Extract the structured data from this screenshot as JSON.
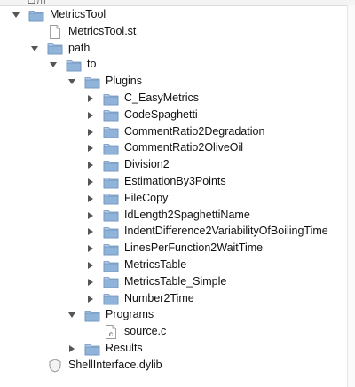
{
  "window": {
    "top_label": "ロ川"
  },
  "tree": [
    {
      "label": "MetricsTool",
      "icon": "folder-icon",
      "expanded": true
    },
    {
      "label": "MetricsTool.st",
      "icon": "file-icon"
    },
    {
      "label": "path",
      "icon": "folder-icon",
      "expanded": true
    },
    {
      "label": "to",
      "icon": "folder-icon",
      "expanded": true
    },
    {
      "label": "Plugins",
      "icon": "folder-icon",
      "expanded": true
    },
    {
      "label": "C_EasyMetrics",
      "icon": "folder-icon",
      "expanded": false
    },
    {
      "label": "CodeSpaghetti",
      "icon": "folder-icon",
      "expanded": false
    },
    {
      "label": "CommentRatio2Degradation",
      "icon": "folder-icon",
      "expanded": false
    },
    {
      "label": "CommentRatio2OliveOil",
      "icon": "folder-icon",
      "expanded": false
    },
    {
      "label": "Division2",
      "icon": "folder-icon",
      "expanded": false
    },
    {
      "label": "EstimationBy3Points",
      "icon": "folder-icon",
      "expanded": false
    },
    {
      "label": "FileCopy",
      "icon": "folder-icon",
      "expanded": false
    },
    {
      "label": "IdLength2SpaghettiName",
      "icon": "folder-icon",
      "expanded": false
    },
    {
      "label": "IndentDifference2VariabilityOfBoilingTime",
      "icon": "folder-icon",
      "expanded": false
    },
    {
      "label": "LinesPerFunction2WaitTime",
      "icon": "folder-icon",
      "expanded": false
    },
    {
      "label": "MetricsTable",
      "icon": "folder-icon",
      "expanded": false
    },
    {
      "label": "MetricsTable_Simple",
      "icon": "folder-icon",
      "expanded": false
    },
    {
      "label": "Number2Time",
      "icon": "folder-icon",
      "expanded": false
    },
    {
      "label": "Programs",
      "icon": "folder-icon",
      "expanded": true
    },
    {
      "label": "source.c",
      "icon": "c-source-file-icon"
    },
    {
      "label": "Results",
      "icon": "folder-icon",
      "expanded": false
    },
    {
      "label": "ShellInterface.dylib",
      "icon": "dylib-shield-icon"
    }
  ],
  "colors": {
    "folder_body": "#8fb3d9",
    "folder_top": "#b4cdea",
    "folder_edge": "#6f93bb",
    "triangle": "#555555"
  }
}
